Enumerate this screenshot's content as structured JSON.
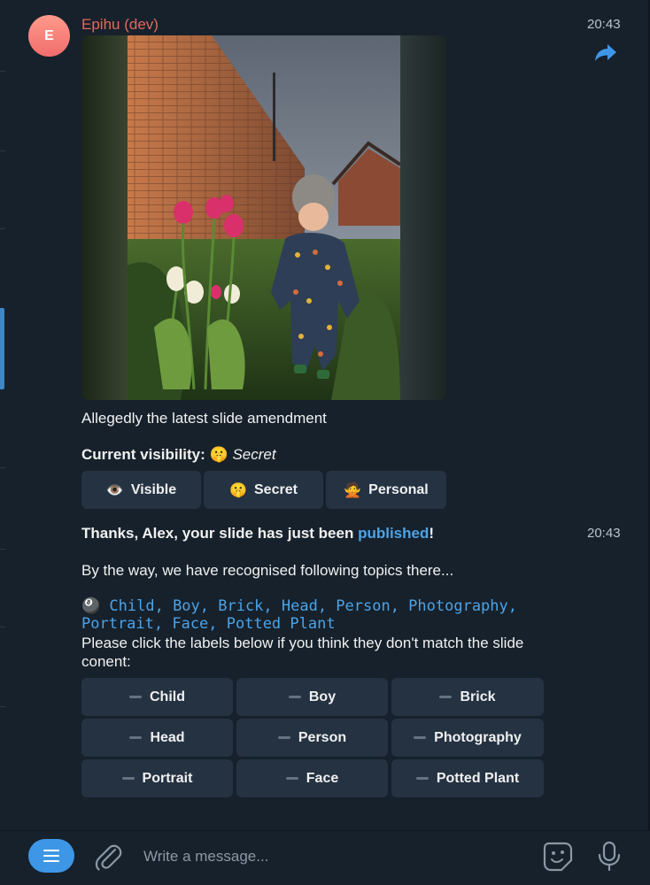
{
  "message1": {
    "avatar_letter": "E",
    "sender": "Epihu (dev)",
    "time": "20:43",
    "caption": "Allegedly the latest slide amendment",
    "visibility_label": "Current visibility:",
    "visibility_emoji": "🤫",
    "visibility_value": "Secret",
    "buttons": [
      {
        "emoji": "👁️",
        "label": "Visible"
      },
      {
        "emoji": "🤫",
        "label": "Secret"
      },
      {
        "emoji": "🙅",
        "label": "Personal"
      }
    ]
  },
  "message2": {
    "time": "20:43",
    "thanks_prefix": "Thanks, Alex, your slide has just been ",
    "thanks_link": "published",
    "thanks_suffix": "!",
    "topics_intro": "By the way, we have recognised following topics there...",
    "topics_emoji": "🎱",
    "topics_line1": "Child, Boy, Brick, Head, Person, Photography,",
    "topics_line2": "Portrait, Face, Potted Plant",
    "instruction": "Please click the labels below if you think they don't match the slide conent:",
    "labels": [
      "Child",
      "Boy",
      "Brick",
      "Head",
      "Person",
      "Photography",
      "Portrait",
      "Face",
      "Potted Plant"
    ]
  },
  "composer": {
    "placeholder": "Write a message..."
  },
  "colors": {
    "background": "#17212b",
    "button": "#243242",
    "accent": "#3e97e6",
    "link": "#4ba3e8",
    "sender": "#e06a5d"
  },
  "icons": [
    "forward-icon",
    "menu-icon",
    "paperclip-icon",
    "sticker-icon",
    "microphone-icon"
  ]
}
